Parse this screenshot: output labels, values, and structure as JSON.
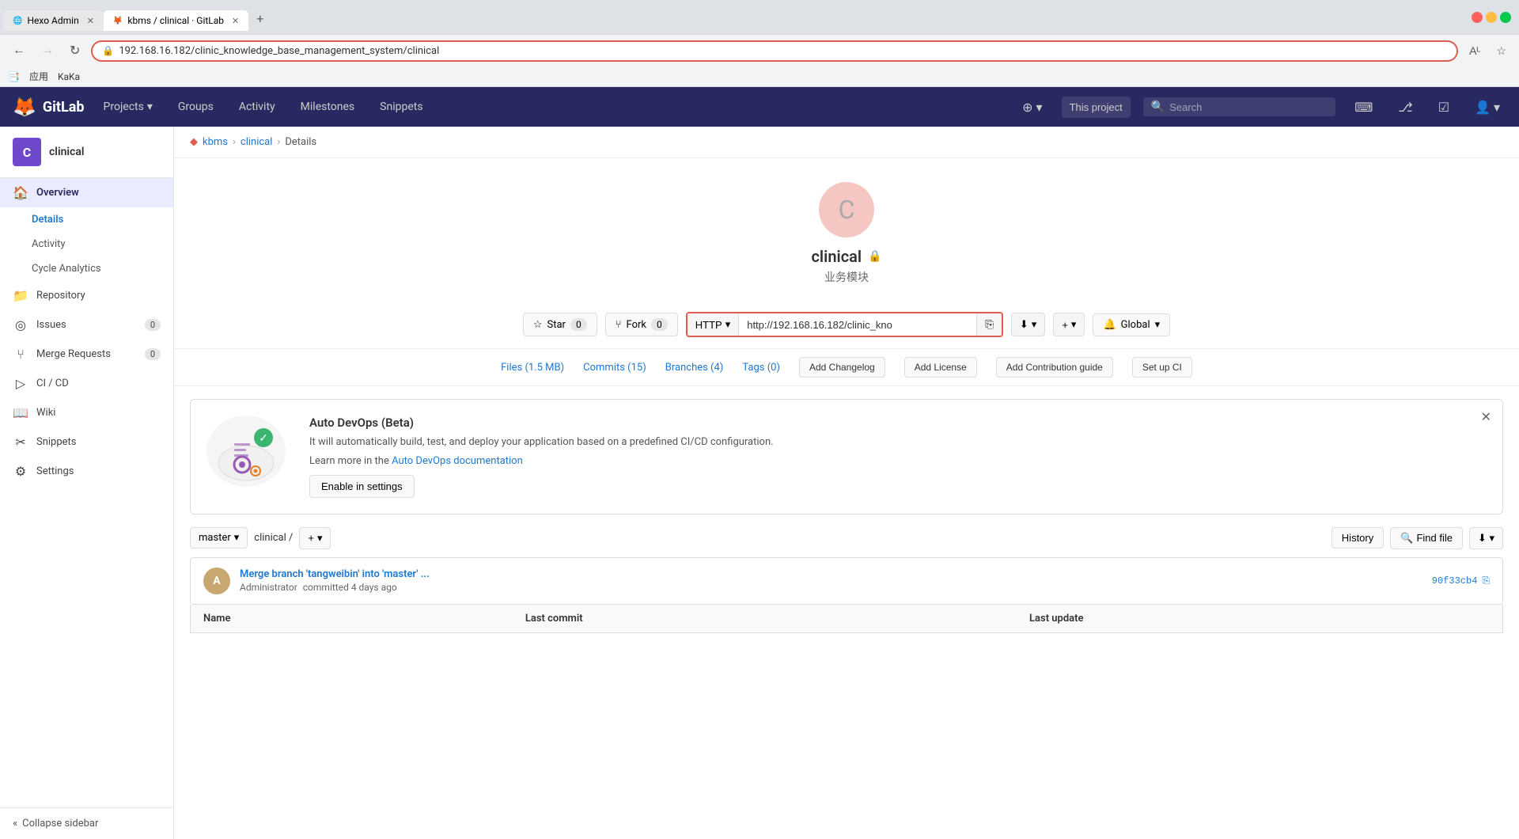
{
  "browser": {
    "tabs": [
      {
        "id": "tab-hexo",
        "label": "Hexo Admin",
        "favicon": "🌐",
        "active": false
      },
      {
        "id": "tab-gitlab",
        "label": "kbms / clinical · GitLab",
        "favicon": "🦊",
        "active": true
      }
    ],
    "url": "192.168.16.182/clinic_knowledge_base_management_system/clinical",
    "bookmarks": [
      {
        "label": "应用"
      },
      {
        "label": "KaKa"
      }
    ]
  },
  "gitlab_nav": {
    "logo": "GitLab",
    "items": [
      "Projects",
      "Groups",
      "Activity",
      "Milestones",
      "Snippets"
    ],
    "this_project": "This project",
    "search_placeholder": "Search"
  },
  "sidebar": {
    "project_initial": "C",
    "project_name": "clinical",
    "menu": {
      "overview": "Overview",
      "overview_sub": [
        "Details",
        "Activity",
        "Cycle Analytics"
      ],
      "repository": "Repository",
      "issues": "Issues",
      "issues_count": "0",
      "merge_requests": "Merge Requests",
      "merge_requests_count": "0",
      "ci_cd": "CI / CD",
      "wiki": "Wiki",
      "snippets": "Snippets",
      "settings": "Settings"
    },
    "collapse": "Collapse sidebar"
  },
  "breadcrumb": {
    "items": [
      "kbms",
      "clinical",
      "Details"
    ]
  },
  "project": {
    "initial": "C",
    "name": "clinical",
    "subtitle": "业务模块",
    "visibility_icon": "🔒"
  },
  "clone": {
    "protocol": "HTTP",
    "url": "http://192.168.16.182/clinic_kno",
    "full_url": "http://192.168.16.182/clinic_kno"
  },
  "stats": {
    "files_label": "Files (1.5 MB)",
    "commits_label": "Commits (15)",
    "branches_label": "Branches (4)",
    "tags_label": "Tags (0)",
    "add_changelog": "Add Changelog",
    "add_license": "Add License",
    "add_contribution_guide": "Add Contribution guide",
    "set_up_ci": "Set up CI"
  },
  "devops": {
    "title": "Auto DevOps (Beta)",
    "description": "It will automatically build, test, and deploy your application based on a predefined CI/CD configuration.",
    "learn_more_prefix": "Learn more in the ",
    "learn_more_link": "Auto DevOps documentation",
    "enable_btn": "Enable in settings"
  },
  "file_browser": {
    "branch": "master",
    "path": "clinical /",
    "history_btn": "History",
    "find_file_btn": "Find file",
    "commit_message": "Merge branch 'tangweibin' into 'master'",
    "commit_suffix": "...",
    "commit_author": "Administrator",
    "commit_time": "committed 4 days ago",
    "commit_hash": "90f33cb4",
    "table_headers": [
      "Name",
      "Last commit",
      "Last update"
    ]
  }
}
